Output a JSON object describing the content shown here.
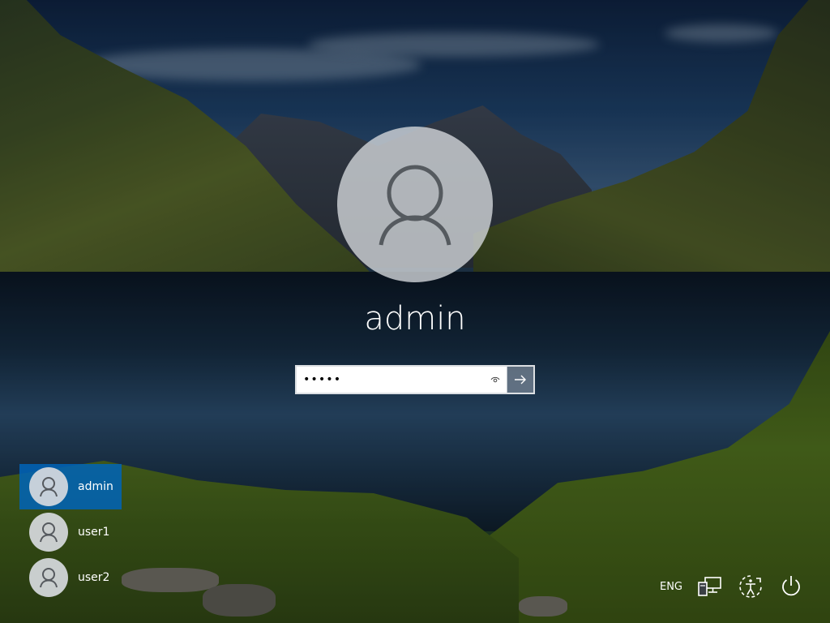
{
  "login": {
    "username": "admin",
    "password_value": "•••••"
  },
  "users": [
    {
      "name": "admin",
      "selected": true
    },
    {
      "name": "user1",
      "selected": false
    },
    {
      "name": "user2",
      "selected": false
    }
  ],
  "tray": {
    "language": "ENG"
  },
  "icons": {
    "large_avatar": "user-icon",
    "reveal": "eye-icon",
    "submit": "arrow-right-icon",
    "network": "network-icon",
    "ease_of_access": "ease-of-access-icon",
    "power": "power-icon"
  },
  "colors": {
    "selected_user_bg": "#0064b8",
    "text": "#ffffff"
  }
}
